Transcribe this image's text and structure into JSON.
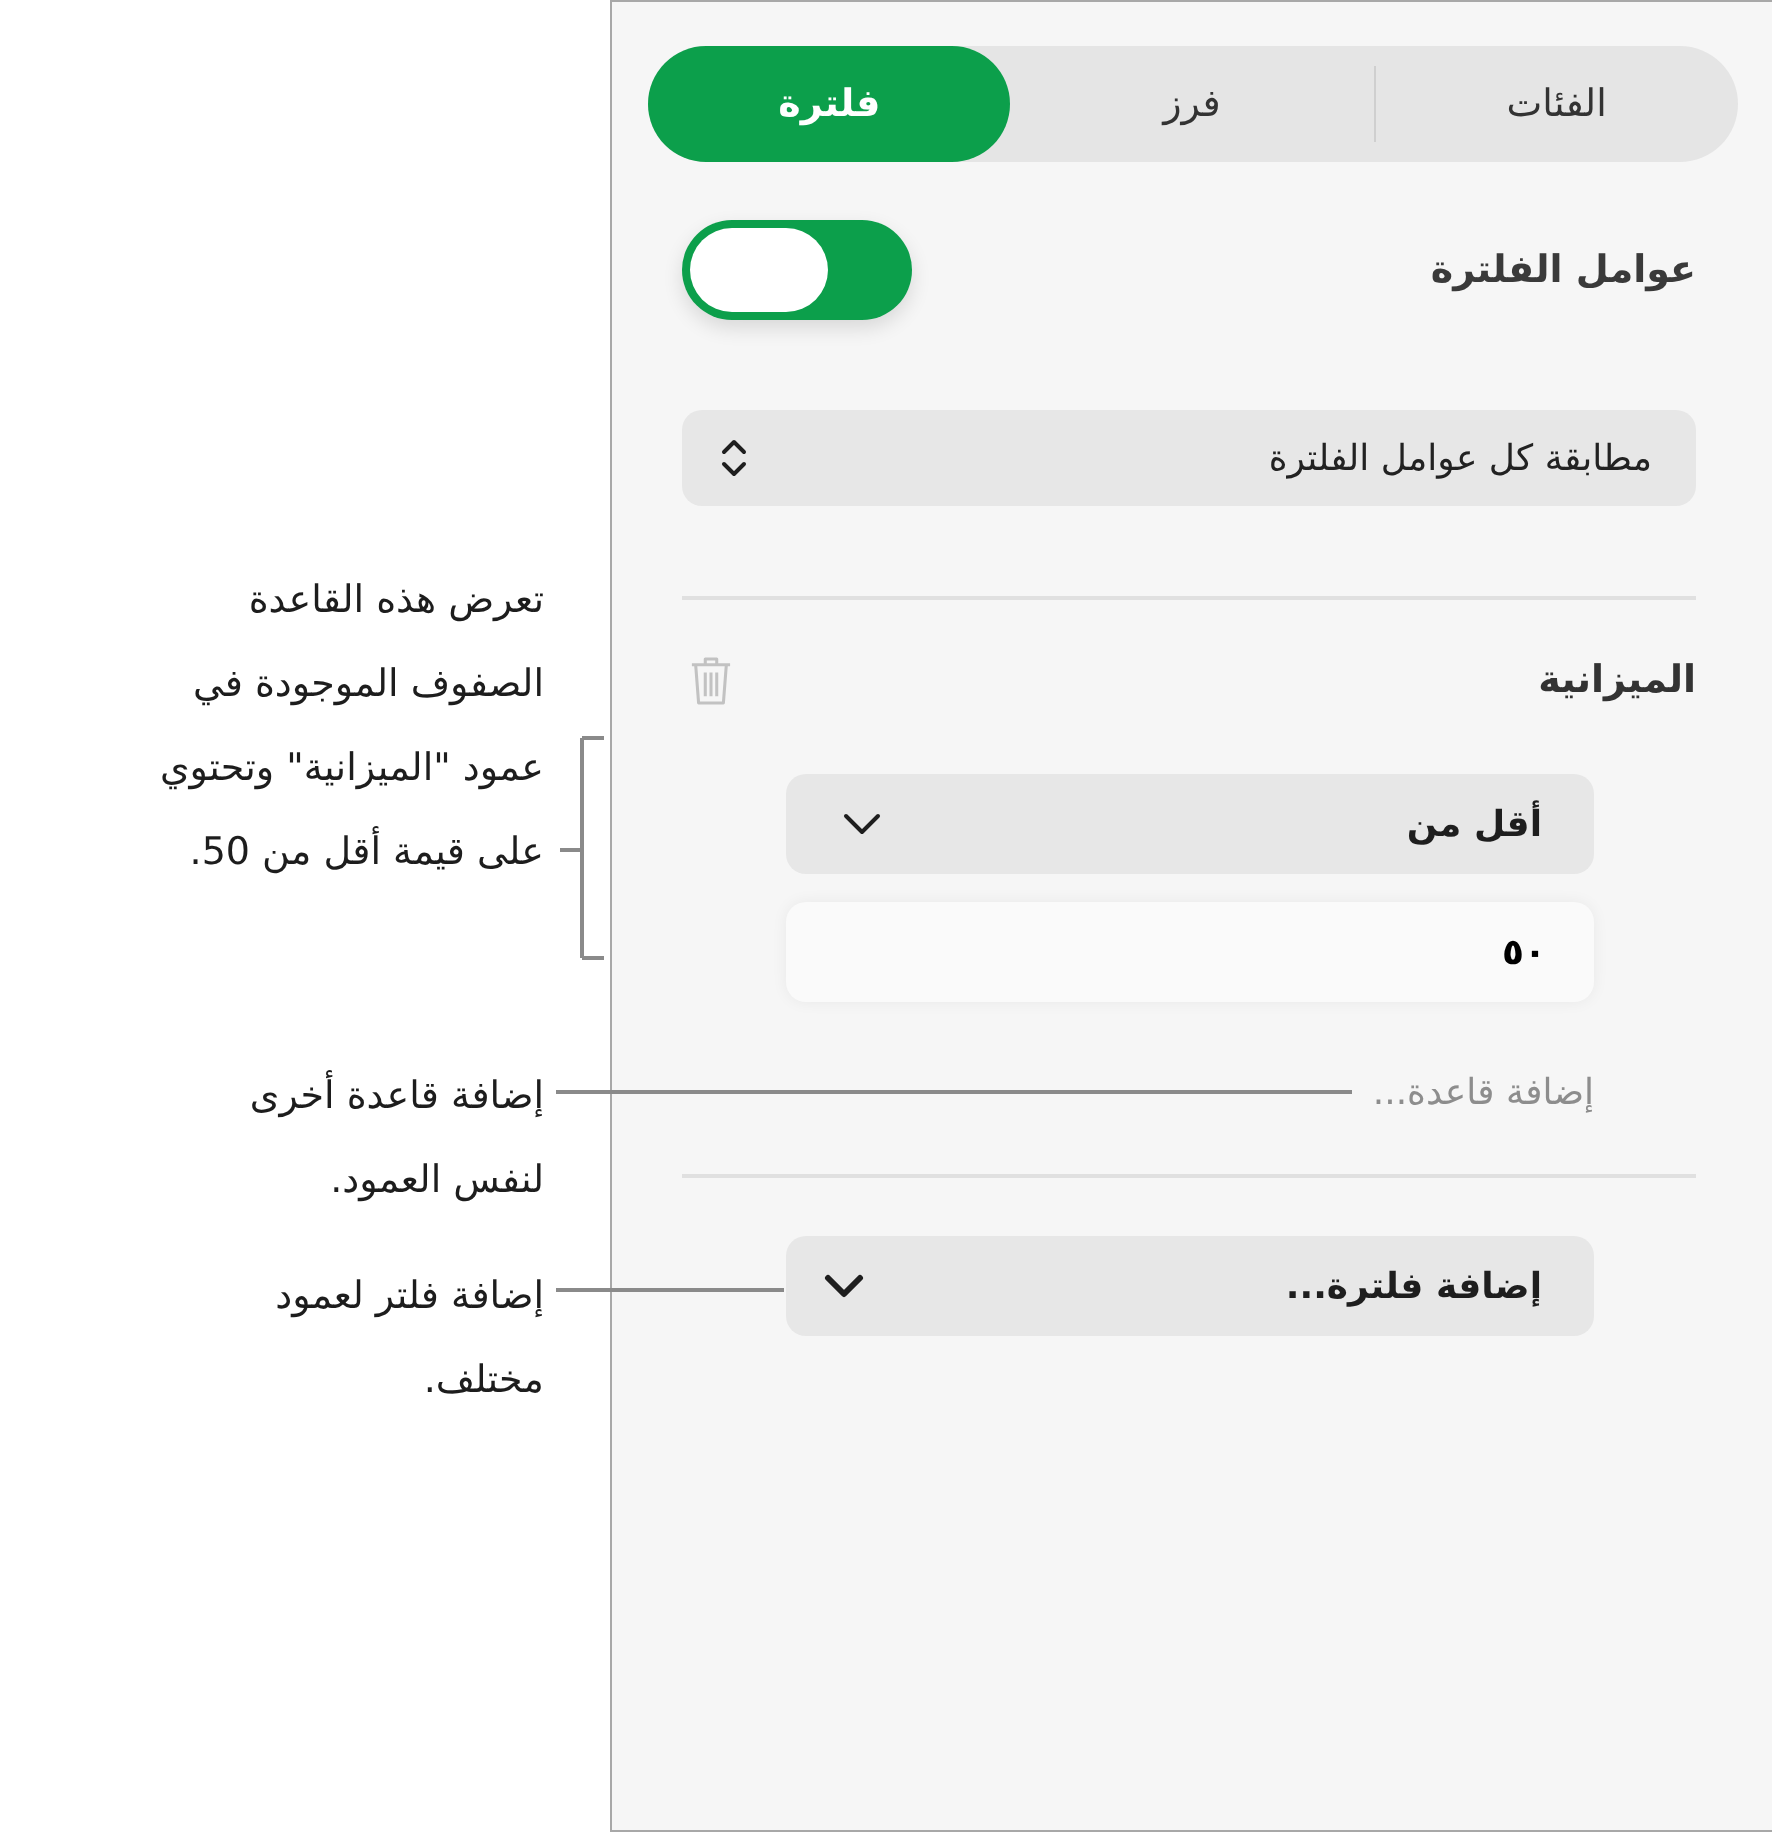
{
  "callouts": [
    {
      "kind": "bracket",
      "text": "تعرض هذه القاعدة\nالصفوف الموجودة في\nعمود \"الميزانية\" وتحتوي\nعلى قيمة أقل من 50."
    },
    {
      "kind": "leader",
      "text": "إضافة قاعدة أخرى\nلنفس العمود."
    },
    {
      "kind": "leader",
      "text": "إضافة فلتر لعمود\nمختلف."
    }
  ],
  "tabs": [
    {
      "label": "الفئات",
      "selected": false
    },
    {
      "label": "فرز",
      "selected": false
    },
    {
      "label": "فلترة",
      "selected": true
    }
  ],
  "filters_toggle": {
    "label": "عوامل الفلترة",
    "on": true
  },
  "match_popup": {
    "value": "مطابقة كل عوامل الفلترة"
  },
  "rule_group": {
    "column": "الميزانية",
    "condition": {
      "value": "أقل من"
    },
    "value_field": {
      "value": "٥٠"
    },
    "add_rule": "إضافة قاعدة..."
  },
  "add_filter": {
    "value": "إضافة فلترة..."
  }
}
